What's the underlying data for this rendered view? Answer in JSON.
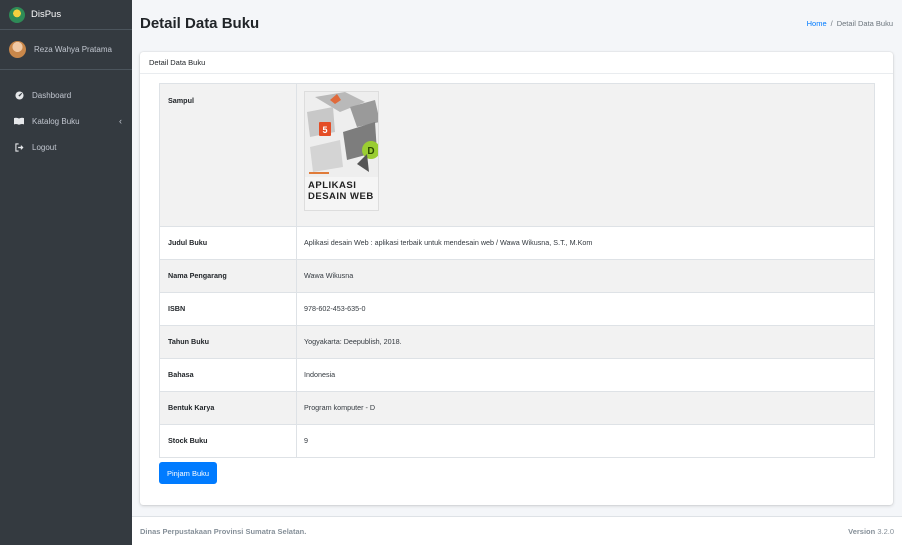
{
  "brand": {
    "name": "DisPus"
  },
  "user": {
    "name": "Reza Wahya Pratama"
  },
  "nav": [
    {
      "label": "Dashboard",
      "icon": "dashboard-icon"
    },
    {
      "label": "Katalog Buku",
      "icon": "book-icon",
      "arrow": "‹"
    },
    {
      "label": "Logout",
      "icon": "logout-icon"
    }
  ],
  "header": {
    "title": "Detail Data Buku",
    "breadcrumb_home": "Home",
    "breadcrumb_sep": "/",
    "breadcrumb_current": "Detail Data Buku"
  },
  "card": {
    "title": "Detail Data Buku",
    "rows": [
      {
        "label": "Sampul"
      },
      {
        "label": "Judul Buku",
        "value": "Aplikasi desain Web : aplikasi terbaik untuk mendesain web / Wawa Wikusna, S.T., M.Kom"
      },
      {
        "label": "Nama Pengarang",
        "value": "Wawa Wikusna"
      },
      {
        "label": "ISBN",
        "value": "978-602-453-635-0"
      },
      {
        "label": "Tahun Buku",
        "value": "Yogyakarta: Deepublish, 2018."
      },
      {
        "label": "Bahasa",
        "value": "Indonesia"
      },
      {
        "label": "Bentuk Karya",
        "value": "Program komputer - D"
      },
      {
        "label": "Stock Buku",
        "value": "9"
      }
    ],
    "cover": {
      "line1": "APLIKASI",
      "line2": "DESAIN WEB"
    },
    "button": "Pinjam Buku"
  },
  "footer": {
    "left": "Dinas Perpustakaan Provinsi Sumatra Selatan.",
    "version_label": "Version",
    "version": "3.2.0"
  },
  "colors": {
    "sidebar": "#343a40",
    "primary": "#007bff",
    "background": "#f4f6f9"
  }
}
